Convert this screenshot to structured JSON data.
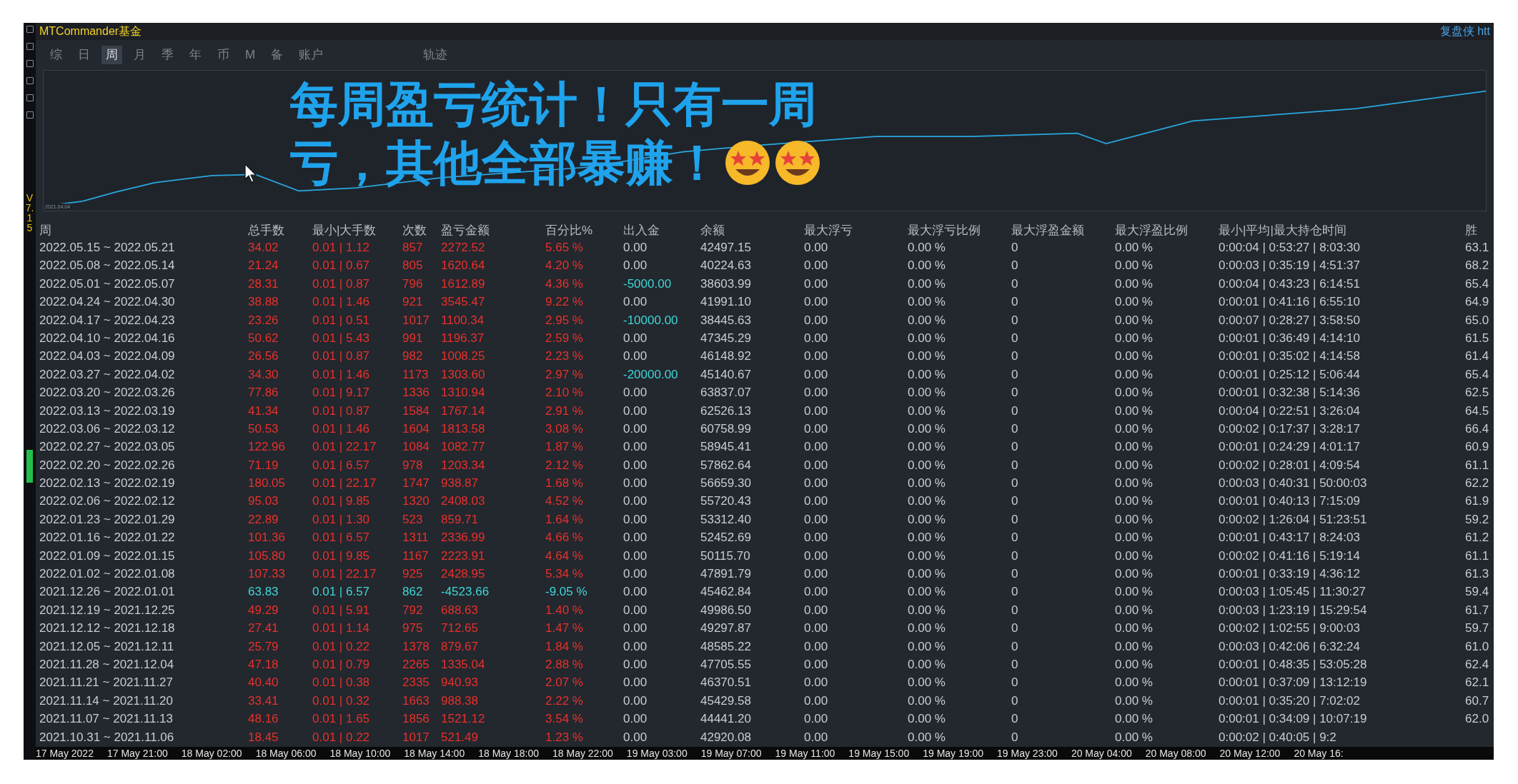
{
  "window": {
    "title": "MTCommander基金",
    "top_right": "复盘侠 htt",
    "version": "V7.15"
  },
  "tabs": [
    {
      "label": "综",
      "selected": false
    },
    {
      "label": "日",
      "selected": false
    },
    {
      "label": "周",
      "selected": true
    },
    {
      "label": "月",
      "selected": false
    },
    {
      "label": "季",
      "selected": false
    },
    {
      "label": "年",
      "selected": false
    },
    {
      "label": "币",
      "selected": false
    },
    {
      "label": "M",
      "selected": false
    },
    {
      "label": "备",
      "selected": false
    },
    {
      "label": "账户",
      "selected": false
    },
    {
      "label": "轨迹",
      "selected": false
    }
  ],
  "chart": {
    "start_label": "2021.04.04"
  },
  "caption": {
    "lines": [
      "每周盈亏统计！只有一周",
      "亏，其他全部暴赚！"
    ],
    "emojis": [
      {
        "kind": "star_eyes"
      },
      {
        "kind": "star_eyes"
      }
    ]
  },
  "table": {
    "columns": [
      "周",
      "总手数",
      "最小|大手数",
      "次数",
      "盈亏金额",
      "百分比%",
      "出入金",
      "余额",
      "最大浮亏",
      "最大浮亏比例",
      "最大浮盈金额",
      "最大浮盈比例",
      "最小|平均|最大持仓时间",
      "胜"
    ],
    "rows": [
      {
        "loss": false,
        "withdrawal": false,
        "cells": [
          "2022.05.15 ~ 2022.05.21",
          "34.02",
          "0.01 | 1.12",
          "857",
          "2272.52",
          "5.65 %",
          "0.00",
          "42497.15",
          "0.00",
          "0.00 %",
          "0",
          "0.00 %",
          "0:00:04 | 0:53:27 | 8:03:30",
          "63.1"
        ]
      },
      {
        "loss": false,
        "withdrawal": false,
        "cells": [
          "2022.05.08 ~ 2022.05.14",
          "21.24",
          "0.01 | 0.67",
          "805",
          "1620.64",
          "4.20 %",
          "0.00",
          "40224.63",
          "0.00",
          "0.00 %",
          "0",
          "0.00 %",
          "0:00:03 | 0:35:19 | 4:51:37",
          "68.2"
        ]
      },
      {
        "loss": false,
        "withdrawal": true,
        "cells": [
          "2022.05.01 ~ 2022.05.07",
          "28.31",
          "0.01 | 0.87",
          "796",
          "1612.89",
          "4.36 %",
          "-5000.00",
          "38603.99",
          "0.00",
          "0.00 %",
          "0",
          "0.00 %",
          "0:00:04 | 0:43:23 | 6:14:51",
          "65.4"
        ]
      },
      {
        "loss": false,
        "withdrawal": false,
        "cells": [
          "2022.04.24 ~ 2022.04.30",
          "38.88",
          "0.01 | 1.46",
          "921",
          "3545.47",
          "9.22 %",
          "0.00",
          "41991.10",
          "0.00",
          "0.00 %",
          "0",
          "0.00 %",
          "0:00:01 | 0:41:16 | 6:55:10",
          "64.9"
        ]
      },
      {
        "loss": false,
        "withdrawal": true,
        "cells": [
          "2022.04.17 ~ 2022.04.23",
          "23.26",
          "0.01 | 0.51",
          "1017",
          "1100.34",
          "2.95 %",
          "-10000.00",
          "38445.63",
          "0.00",
          "0.00 %",
          "0",
          "0.00 %",
          "0:00:07 | 0:28:27 | 3:58:50",
          "65.0"
        ]
      },
      {
        "loss": false,
        "withdrawal": false,
        "cells": [
          "2022.04.10 ~ 2022.04.16",
          "50.62",
          "0.01 | 5.43",
          "991",
          "1196.37",
          "2.59 %",
          "0.00",
          "47345.29",
          "0.00",
          "0.00 %",
          "0",
          "0.00 %",
          "0:00:01 | 0:36:49 | 4:14:10",
          "61.5"
        ]
      },
      {
        "loss": false,
        "withdrawal": false,
        "cells": [
          "2022.04.03 ~ 2022.04.09",
          "26.56",
          "0.01 | 0.87",
          "982",
          "1008.25",
          "2.23 %",
          "0.00",
          "46148.92",
          "0.00",
          "0.00 %",
          "0",
          "0.00 %",
          "0:00:01 | 0:35:02 | 4:14:58",
          "61.4"
        ]
      },
      {
        "loss": false,
        "withdrawal": true,
        "cells": [
          "2022.03.27 ~ 2022.04.02",
          "34.30",
          "0.01 | 1.46",
          "1173",
          "1303.60",
          "2.97 %",
          "-20000.00",
          "45140.67",
          "0.00",
          "0.00 %",
          "0",
          "0.00 %",
          "0:00:01 | 0:25:12 | 5:06:44",
          "65.4"
        ]
      },
      {
        "loss": false,
        "withdrawal": false,
        "cells": [
          "2022.03.20 ~ 2022.03.26",
          "77.86",
          "0.01 | 9.17",
          "1336",
          "1310.94",
          "2.10 %",
          "0.00",
          "63837.07",
          "0.00",
          "0.00 %",
          "0",
          "0.00 %",
          "0:00:01 | 0:32:38 | 5:14:36",
          "62.5"
        ]
      },
      {
        "loss": false,
        "withdrawal": false,
        "cells": [
          "2022.03.13 ~ 2022.03.19",
          "41.34",
          "0.01 | 0.87",
          "1584",
          "1767.14",
          "2.91 %",
          "0.00",
          "62526.13",
          "0.00",
          "0.00 %",
          "0",
          "0.00 %",
          "0:00:04 | 0:22:51 | 3:26:04",
          "64.5"
        ]
      },
      {
        "loss": false,
        "withdrawal": false,
        "cells": [
          "2022.03.06 ~ 2022.03.12",
          "50.53",
          "0.01 | 1.46",
          "1604",
          "1813.58",
          "3.08 %",
          "0.00",
          "60758.99",
          "0.00",
          "0.00 %",
          "0",
          "0.00 %",
          "0:00:02 | 0:17:37 | 3:28:17",
          "66.4"
        ]
      },
      {
        "loss": false,
        "withdrawal": false,
        "cells": [
          "2022.02.27 ~ 2022.03.05",
          "122.96",
          "0.01 | 22.17",
          "1084",
          "1082.77",
          "1.87 %",
          "0.00",
          "58945.41",
          "0.00",
          "0.00 %",
          "0",
          "0.00 %",
          "0:00:01 | 0:24:29 | 4:01:17",
          "60.9"
        ]
      },
      {
        "loss": false,
        "withdrawal": false,
        "cells": [
          "2022.02.20 ~ 2022.02.26",
          "71.19",
          "0.01 | 6.57",
          "978",
          "1203.34",
          "2.12 %",
          "0.00",
          "57862.64",
          "0.00",
          "0.00 %",
          "0",
          "0.00 %",
          "0:00:02 | 0:28:01 | 4:09:54",
          "61.1"
        ]
      },
      {
        "loss": false,
        "withdrawal": false,
        "cells": [
          "2022.02.13 ~ 2022.02.19",
          "180.05",
          "0.01 | 22.17",
          "1747",
          "938.87",
          "1.68 %",
          "0.00",
          "56659.30",
          "0.00",
          "0.00 %",
          "0",
          "0.00 %",
          "0:00:03 | 0:40:31 | 50:00:03",
          "62.2"
        ]
      },
      {
        "loss": false,
        "withdrawal": false,
        "cells": [
          "2022.02.06 ~ 2022.02.12",
          "95.03",
          "0.01 | 9.85",
          "1320",
          "2408.03",
          "4.52 %",
          "0.00",
          "55720.43",
          "0.00",
          "0.00 %",
          "0",
          "0.00 %",
          "0:00:01 | 0:40:13 | 7:15:09",
          "61.9"
        ]
      },
      {
        "loss": false,
        "withdrawal": false,
        "cells": [
          "2022.01.23 ~ 2022.01.29",
          "22.89",
          "0.01 | 1.30",
          "523",
          "859.71",
          "1.64 %",
          "0.00",
          "53312.40",
          "0.00",
          "0.00 %",
          "0",
          "0.00 %",
          "0:00:02 | 1:26:04 | 51:23:51",
          "59.2"
        ]
      },
      {
        "loss": false,
        "withdrawal": false,
        "cells": [
          "2022.01.16 ~ 2022.01.22",
          "101.36",
          "0.01 | 6.57",
          "1311",
          "2336.99",
          "4.66 %",
          "0.00",
          "52452.69",
          "0.00",
          "0.00 %",
          "0",
          "0.00 %",
          "0:00:01 | 0:43:17 | 8:24:03",
          "61.2"
        ]
      },
      {
        "loss": false,
        "withdrawal": false,
        "cells": [
          "2022.01.09 ~ 2022.01.15",
          "105.80",
          "0.01 | 9.85",
          "1167",
          "2223.91",
          "4.64 %",
          "0.00",
          "50115.70",
          "0.00",
          "0.00 %",
          "0",
          "0.00 %",
          "0:00:02 | 0:41:16 | 5:19:14",
          "61.1"
        ]
      },
      {
        "loss": false,
        "withdrawal": false,
        "cells": [
          "2022.01.02 ~ 2022.01.08",
          "107.33",
          "0.01 | 22.17",
          "925",
          "2428.95",
          "5.34 %",
          "0.00",
          "47891.79",
          "0.00",
          "0.00 %",
          "0",
          "0.00 %",
          "0:00:01 | 0:33:19 | 4:36:12",
          "61.3"
        ]
      },
      {
        "loss": true,
        "withdrawal": false,
        "cells": [
          "2021.12.26 ~ 2022.01.01",
          "63.83",
          "0.01 | 6.57",
          "862",
          "-4523.66",
          "-9.05 %",
          "0.00",
          "45462.84",
          "0.00",
          "0.00 %",
          "0",
          "0.00 %",
          "0:00:03 | 1:05:45 | 11:30:27",
          "59.4"
        ]
      },
      {
        "loss": false,
        "withdrawal": false,
        "cells": [
          "2021.12.19 ~ 2021.12.25",
          "49.29",
          "0.01 | 5.91",
          "792",
          "688.63",
          "1.40 %",
          "0.00",
          "49986.50",
          "0.00",
          "0.00 %",
          "0",
          "0.00 %",
          "0:00:03 | 1:23:19 | 15:29:54",
          "61.7"
        ]
      },
      {
        "loss": false,
        "withdrawal": false,
        "cells": [
          "2021.12.12 ~ 2021.12.18",
          "27.41",
          "0.01 | 1.14",
          "975",
          "712.65",
          "1.47 %",
          "0.00",
          "49297.87",
          "0.00",
          "0.00 %",
          "0",
          "0.00 %",
          "0:00:02 | 1:02:55 | 9:00:03",
          "59.7"
        ]
      },
      {
        "loss": false,
        "withdrawal": false,
        "cells": [
          "2021.12.05 ~ 2021.12.11",
          "25.79",
          "0.01 | 0.22",
          "1378",
          "879.67",
          "1.84 %",
          "0.00",
          "48585.22",
          "0.00",
          "0.00 %",
          "0",
          "0.00 %",
          "0:00:03 | 0:42:06 | 6:32:24",
          "61.0"
        ]
      },
      {
        "loss": false,
        "withdrawal": false,
        "cells": [
          "2021.11.28 ~ 2021.12.04",
          "47.18",
          "0.01 | 0.79",
          "2265",
          "1335.04",
          "2.88 %",
          "0.00",
          "47705.55",
          "0.00",
          "0.00 %",
          "0",
          "0.00 %",
          "0:00:01 | 0:48:35 | 53:05:28",
          "62.4"
        ]
      },
      {
        "loss": false,
        "withdrawal": false,
        "cells": [
          "2021.11.21 ~ 2021.11.27",
          "40.40",
          "0.01 | 0.38",
          "2335",
          "940.93",
          "2.07 %",
          "0.00",
          "46370.51",
          "0.00",
          "0.00 %",
          "0",
          "0.00 %",
          "0:00:01 | 0:37:09 | 13:12:19",
          "62.1"
        ]
      },
      {
        "loss": false,
        "withdrawal": false,
        "cells": [
          "2021.11.14 ~ 2021.11.20",
          "33.41",
          "0.01 | 0.32",
          "1663",
          "988.38",
          "2.22 %",
          "0.00",
          "45429.58",
          "0.00",
          "0.00 %",
          "0",
          "0.00 %",
          "0:00:01 | 0:35:20 | 7:02:02",
          "60.7"
        ]
      },
      {
        "loss": false,
        "withdrawal": false,
        "cells": [
          "2021.11.07 ~ 2021.11.13",
          "48.16",
          "0.01 | 1.65",
          "1856",
          "1521.12",
          "3.54 %",
          "0.00",
          "44441.20",
          "0.00",
          "0.00 %",
          "0",
          "0.00 %",
          "0:00:01 | 0:34:09 | 10:07:19",
          "62.0"
        ]
      },
      {
        "loss": false,
        "withdrawal": false,
        "cells": [
          "2021.10.31 ~ 2021.11.06",
          "18.45",
          "0.01 | 0.22",
          "1017",
          "521.49",
          "1.23 %",
          "0.00",
          "42920.08",
          "0.00",
          "0.00 %",
          "0",
          "0.00 %",
          "0:00:02 | 0:40:05 | 9:2"
        ]
      }
    ]
  },
  "time_axis": [
    "17 May 2022",
    "17 May 21:00",
    "18 May 02:00",
    "18 May 06:00",
    "18 May 10:00",
    "18 May 14:00",
    "18 May 18:00",
    "18 May 22:00",
    "19 May 03:00",
    "19 May 07:00",
    "19 May 11:00",
    "19 May 15:00",
    "19 May 19:00",
    "19 May 23:00",
    "20 May 04:00",
    "20 May 08:00",
    "20 May 12:00",
    "20 May 16:"
  ]
}
